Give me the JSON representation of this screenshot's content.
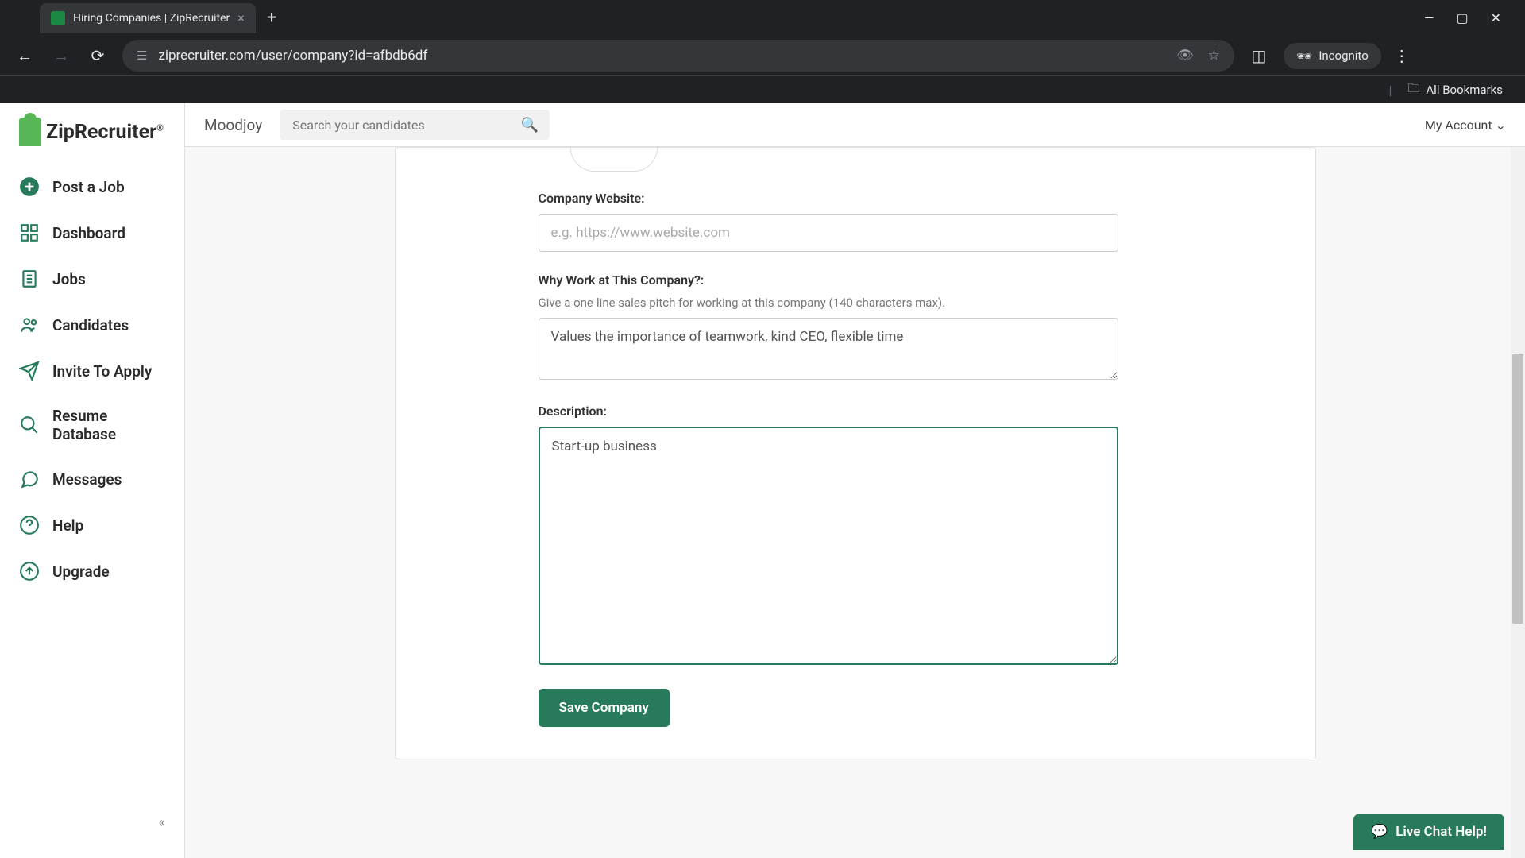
{
  "browser": {
    "tab_title": "Hiring Companies | ZipRecruiter",
    "url": "ziprecruiter.com/user/company?id=afbdb6df",
    "incognito_label": "Incognito",
    "bookmarks_label": "All Bookmarks"
  },
  "logo": {
    "text": "ZipRecruiter"
  },
  "sidebar": {
    "items": [
      {
        "label": "Post a Job",
        "icon": "plus"
      },
      {
        "label": "Dashboard",
        "icon": "grid"
      },
      {
        "label": "Jobs",
        "icon": "document"
      },
      {
        "label": "Candidates",
        "icon": "people"
      },
      {
        "label": "Invite To Apply",
        "icon": "send"
      },
      {
        "label": "Resume Database",
        "icon": "search"
      },
      {
        "label": "Messages",
        "icon": "chat"
      },
      {
        "label": "Help",
        "icon": "help"
      },
      {
        "label": "Upgrade",
        "icon": "upgrade"
      }
    ]
  },
  "topbar": {
    "company": "Moodjoy",
    "search_placeholder": "Search your candidates",
    "account_label": "My Account"
  },
  "form": {
    "website_label": "Company Website:",
    "website_placeholder": "e.g. https://www.website.com",
    "website_value": "",
    "why_label": "Why Work at This Company?:",
    "why_hint": "Give a one-line sales pitch for working at this company (140 characters max).",
    "why_value": "Values the importance of teamwork, kind CEO, flexible time",
    "desc_label": "Description:",
    "desc_value": "Start-up business",
    "save_label": "Save Company"
  },
  "chat": {
    "label": "Live Chat Help!"
  }
}
